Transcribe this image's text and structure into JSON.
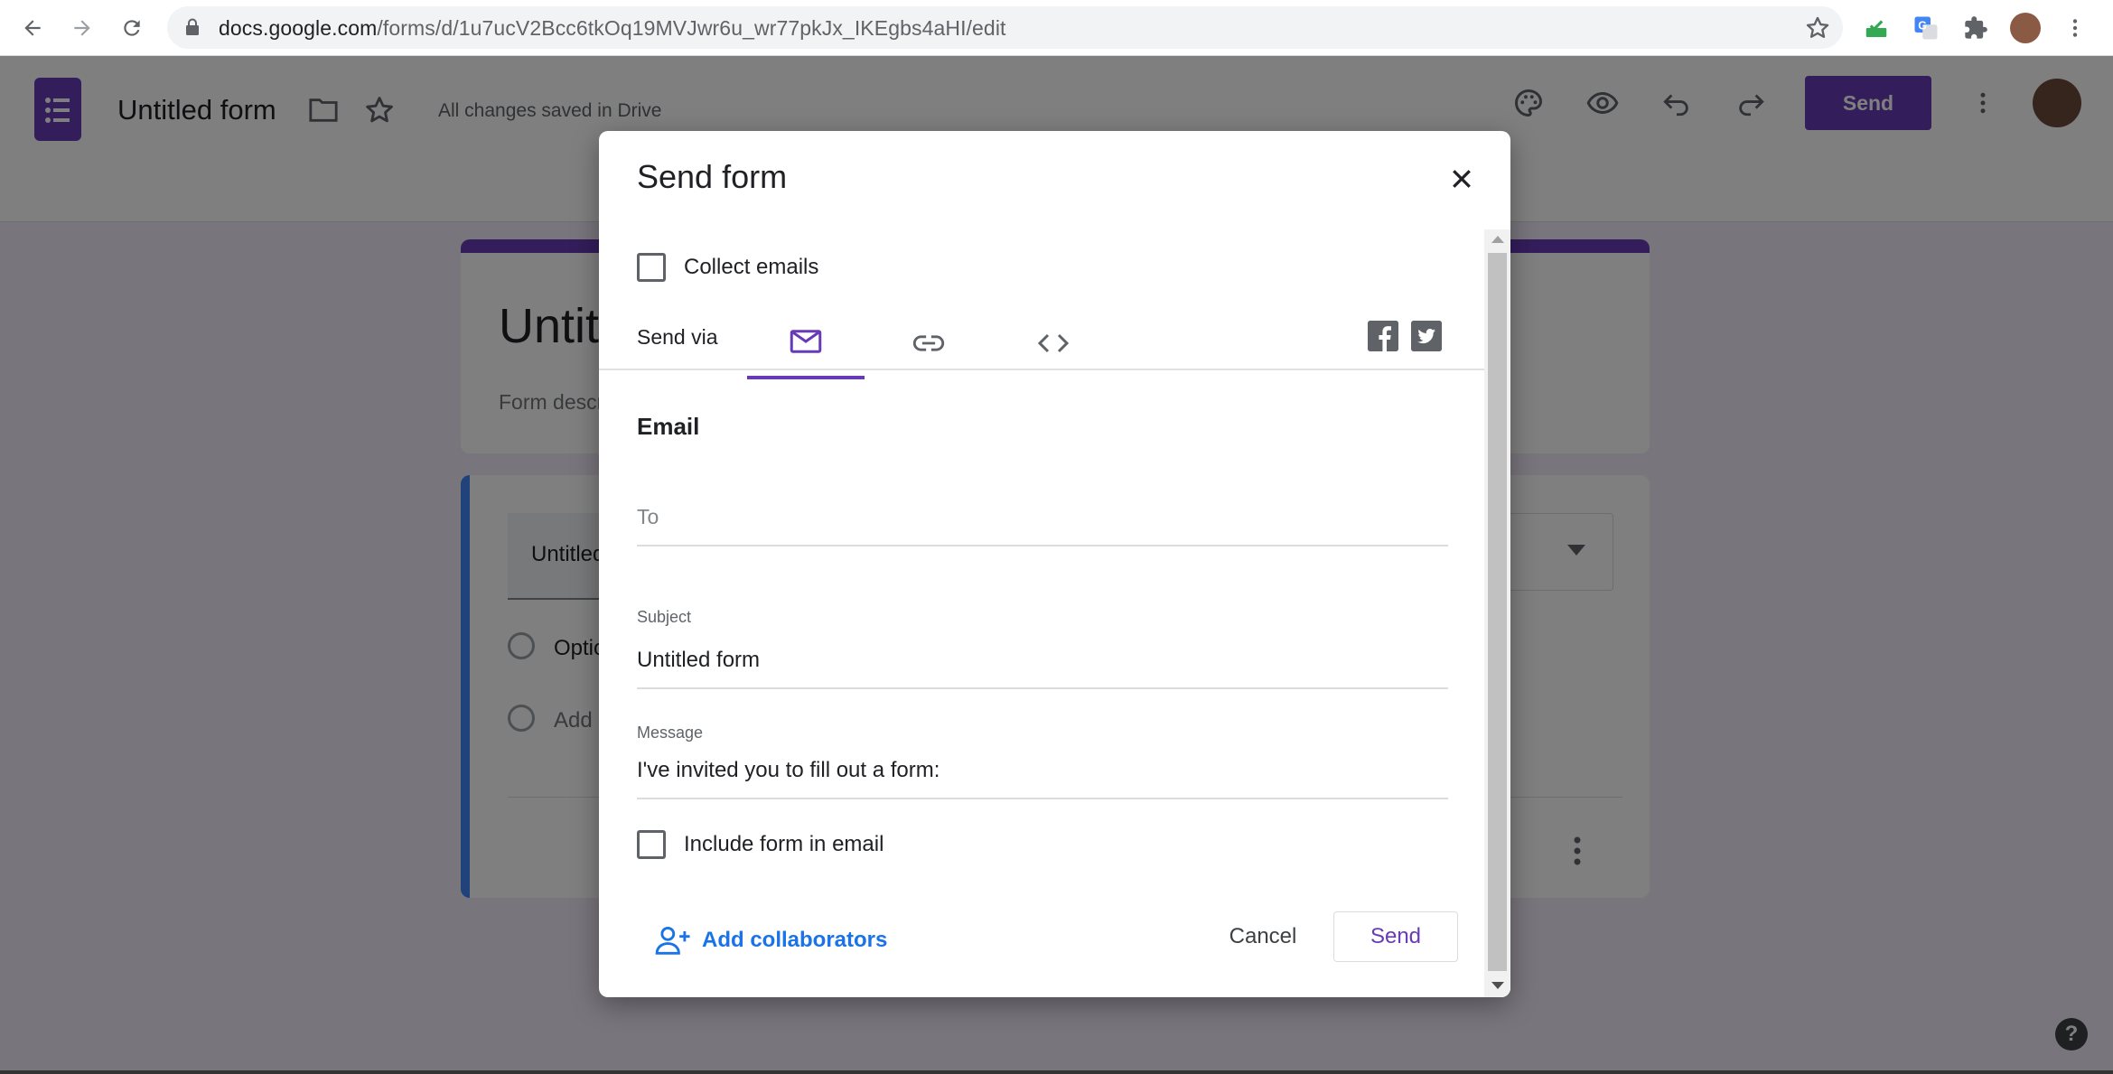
{
  "browser": {
    "url_domain": "docs.google.com",
    "url_path": "/forms/d/1u7ucV2Bcc6tkOq19MVJwr6u_wr77pkJx_IKEgbs4aHI/edit"
  },
  "header": {
    "form_title": "Untitled form",
    "save_status": "All changes saved in Drive",
    "send_label": "Send"
  },
  "form": {
    "title": "Untitled form",
    "description": "Form description",
    "question_title": "Untitled Question",
    "option_1": "Option 1",
    "add_option": "Add option or add \"Other\""
  },
  "dialog": {
    "title": "Send form",
    "collect_emails": "Collect emails",
    "send_via": "Send via",
    "section_title": "Email",
    "to_placeholder": "To",
    "subject_label": "Subject",
    "subject_value": "Untitled form",
    "message_label": "Message",
    "message_value": "I've invited you to fill out a form:",
    "include_form": "Include form in email",
    "add_collaborators": "Add collaborators",
    "cancel": "Cancel",
    "send": "Send"
  },
  "icons": {
    "tabs": [
      "email-icon",
      "link-icon",
      "embed-icon"
    ],
    "social": [
      "facebook-icon",
      "twitter-icon"
    ]
  },
  "colors": {
    "accent": "#673ab7",
    "link": "#1a73e8",
    "question_accent": "#4285f4"
  }
}
